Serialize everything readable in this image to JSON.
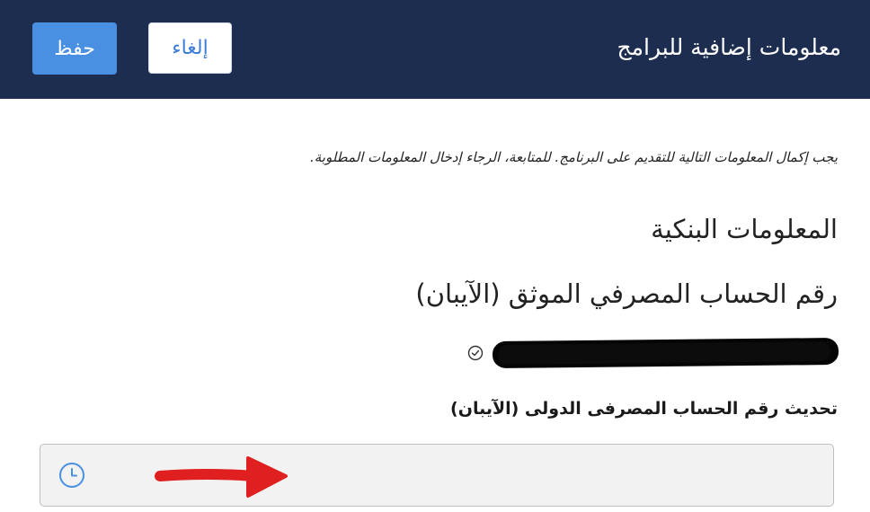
{
  "header": {
    "title": "معلومات إضافية للبرامج",
    "save_label": "حفظ",
    "cancel_label": "إلغاء",
    "background_color": "#1c2d50",
    "save_color": "#4a90e2"
  },
  "main": {
    "notice": "يجب إكمال المعلومات التالية للتقديم على البرنامج. للمتابعة، الرجاء إدخال المعلومات المطلوبة.",
    "section_title": "المعلومات البنكية",
    "iban_title": "رقم الحساب المصرفي الموثق (الآيبان)",
    "verified_icon": "check-circle-icon",
    "update_label": "تحديث رقم الحساب المصرفى الدولى (الآيبان)",
    "input": {
      "value": "",
      "icon": "clock-icon"
    },
    "annotation": {
      "icon": "red-arrow",
      "color": "#e02020"
    }
  }
}
